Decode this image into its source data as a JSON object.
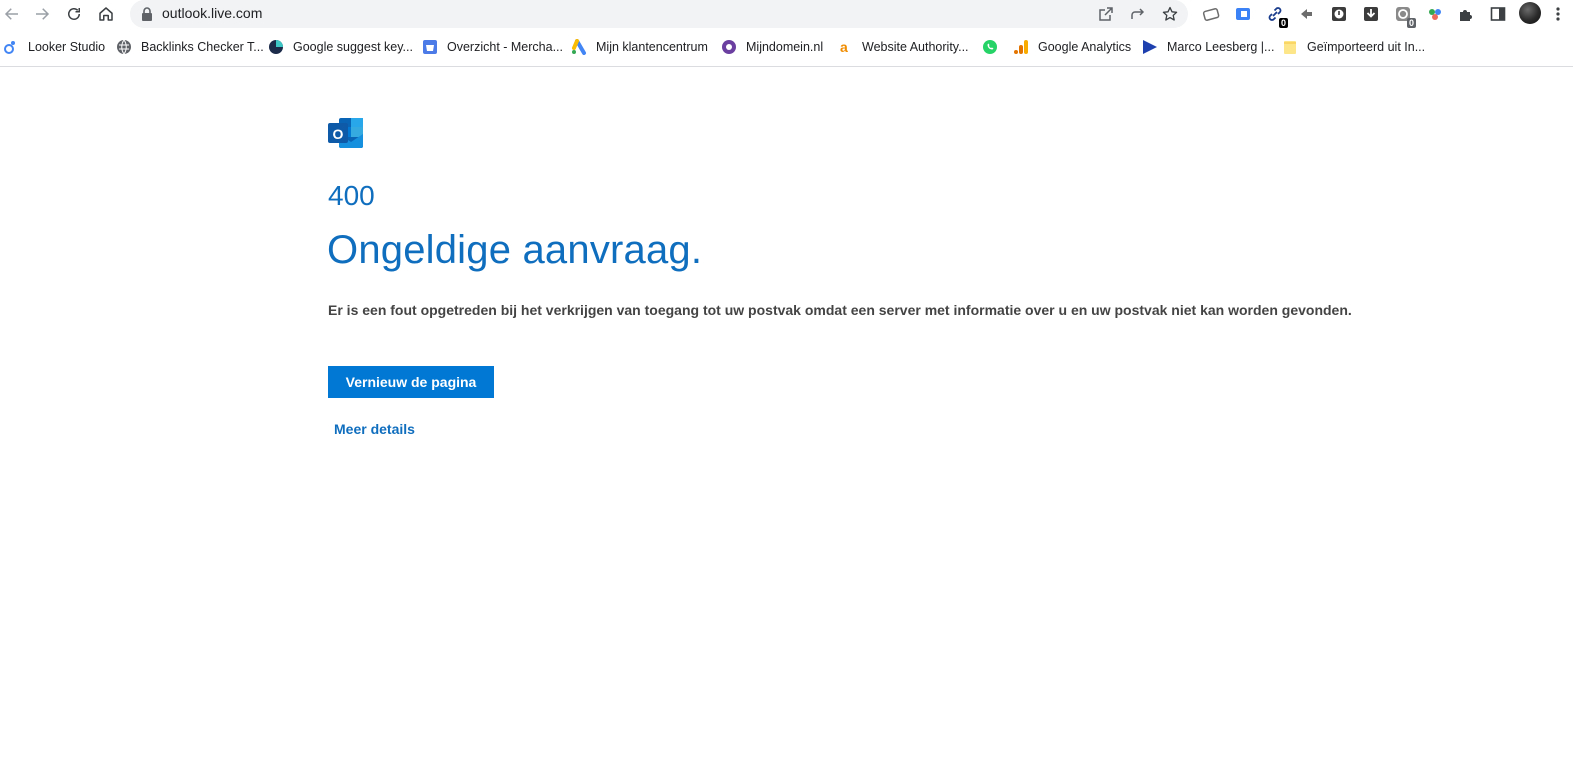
{
  "browser": {
    "url": "outlook.live.com",
    "extension_badges": [
      "0",
      "0"
    ]
  },
  "bookmarks": [
    {
      "label": "Looker Studio",
      "icon": "looker-studio-icon"
    },
    {
      "label": "Backlinks Checker T...",
      "icon": "globe-icon"
    },
    {
      "label": "Google suggest key...",
      "icon": "pie-chart-icon"
    },
    {
      "label": "Overzicht - Mercha...",
      "icon": "merchant-center-icon"
    },
    {
      "label": "Mijn klantencentrum",
      "icon": "google-ads-icon"
    },
    {
      "label": "Mijndomein.nl",
      "icon": "mijndomein-icon"
    },
    {
      "label": "Website Authority...",
      "icon": "ahrefs-icon"
    },
    {
      "label": "",
      "icon": "whatsapp-icon"
    },
    {
      "label": "Google Analytics",
      "icon": "google-analytics-icon"
    },
    {
      "label": "Marco Leesberg |...",
      "icon": "play-triangle-icon"
    },
    {
      "label": "Geïmporteerd uit In...",
      "icon": "folder-icon"
    }
  ],
  "page": {
    "error_code": "400",
    "title": "Ongeldige aanvraag.",
    "message": "Er is een fout opgetreden bij het verkrijgen van toegang tot uw postvak omdat een server met informatie over u en uw postvak niet kan worden gevonden.",
    "refresh_button": "Vernieuw de pagina",
    "details_link": "Meer details"
  },
  "colors": {
    "accent": "#0078d4",
    "heading": "#106ebe",
    "text": "#444444"
  }
}
